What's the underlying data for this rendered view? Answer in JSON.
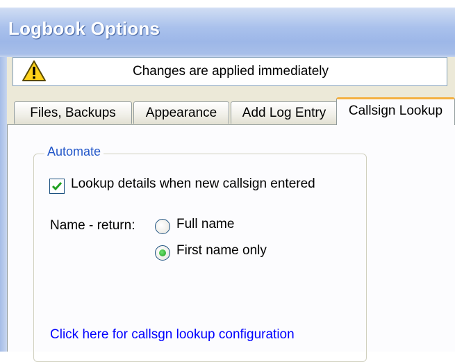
{
  "window": {
    "title": "Logbook Options"
  },
  "notice": {
    "icon": "warning-icon",
    "text": "Changes are applied immediately"
  },
  "tabs": [
    {
      "label": "Files, Backups",
      "active": false
    },
    {
      "label": "Appearance",
      "active": false
    },
    {
      "label": "Add Log Entry",
      "active": false
    },
    {
      "label": "Callsign Lookup",
      "active": true
    }
  ],
  "automate": {
    "legend": "Automate",
    "lookup_checkbox": {
      "label": "Lookup details when new callsign entered",
      "checked": true
    },
    "name_return": {
      "label": "Name - return:",
      "options": [
        {
          "label": "Full name",
          "selected": false
        },
        {
          "label": "First name only",
          "selected": true
        }
      ]
    },
    "config_link": "Click here for callsgn lookup configuration"
  },
  "colors": {
    "accent_tab": "#f4b040",
    "legend": "#2357c9",
    "link": "#0000ff"
  }
}
